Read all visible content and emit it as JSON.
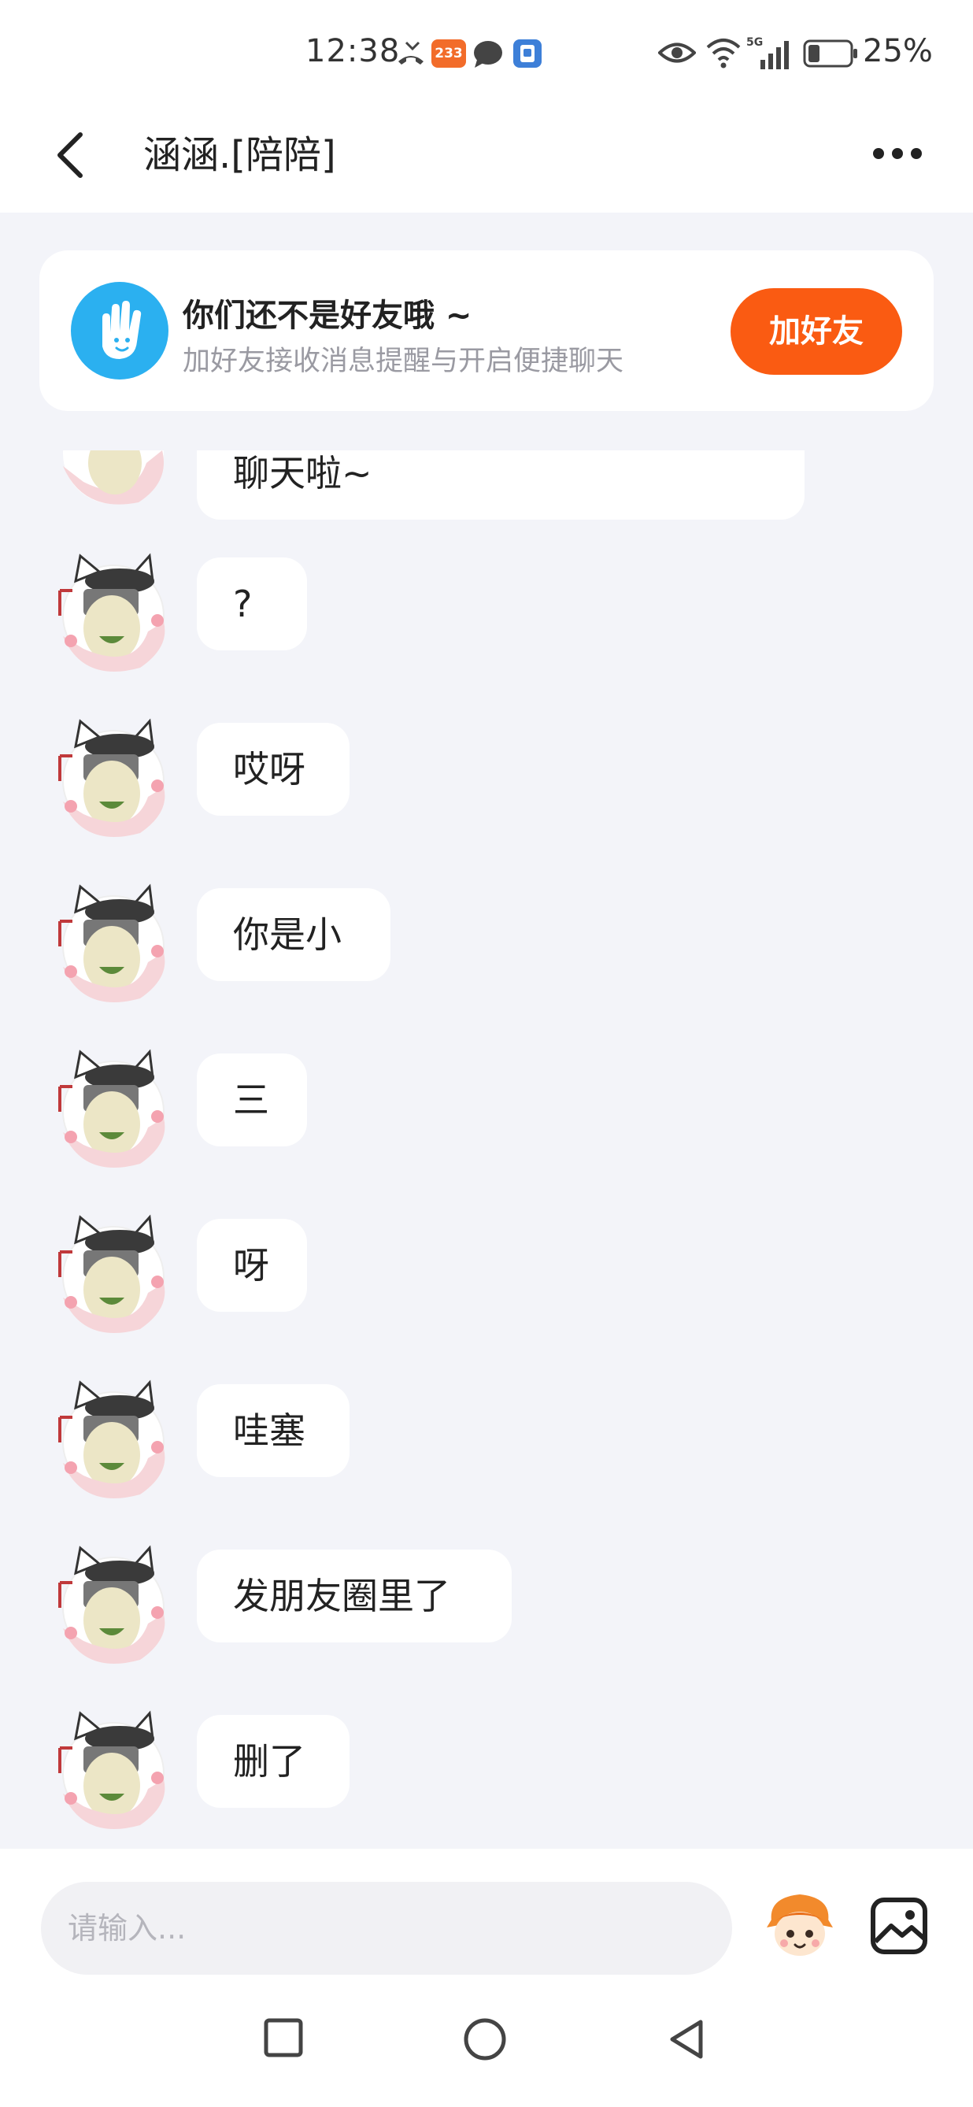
{
  "status_bar": {
    "time": "12:38",
    "notification_badge": "233",
    "battery": "25%",
    "icons": [
      "missed-call-icon",
      "app-badge-icon",
      "message-icon",
      "app-icon",
      "eye-icon",
      "wifi-icon",
      "signal-5g-icon",
      "battery-icon"
    ]
  },
  "header": {
    "title": "涵涵.[陪陪]",
    "back_icon": "chevron-left-icon",
    "more_icon": "more-dots-icon"
  },
  "friend_card": {
    "title": "你们还不是好友哦 ~",
    "subtitle": "加好友接收消息提醒与开启便捷聊天",
    "button_label": "加好友",
    "icon": "hand-wave-icon",
    "accent_color": "#fa5b12",
    "icon_color": "#2bb0f0"
  },
  "messages": [
    {
      "text": "聊天啦~"
    },
    {
      "text": "?"
    },
    {
      "text": "哎呀"
    },
    {
      "text": "你是小"
    },
    {
      "text": "三"
    },
    {
      "text": "呀"
    },
    {
      "text": "哇塞"
    },
    {
      "text": "发朋友圈里了"
    },
    {
      "text": "删了"
    }
  ],
  "input_bar": {
    "placeholder": "请输入...",
    "emoji_icon": "mascot-emoji-icon",
    "image_icon": "image-icon"
  },
  "nav_bar": {
    "buttons": [
      "recent-apps-icon",
      "home-icon",
      "back-triangle-icon"
    ]
  }
}
